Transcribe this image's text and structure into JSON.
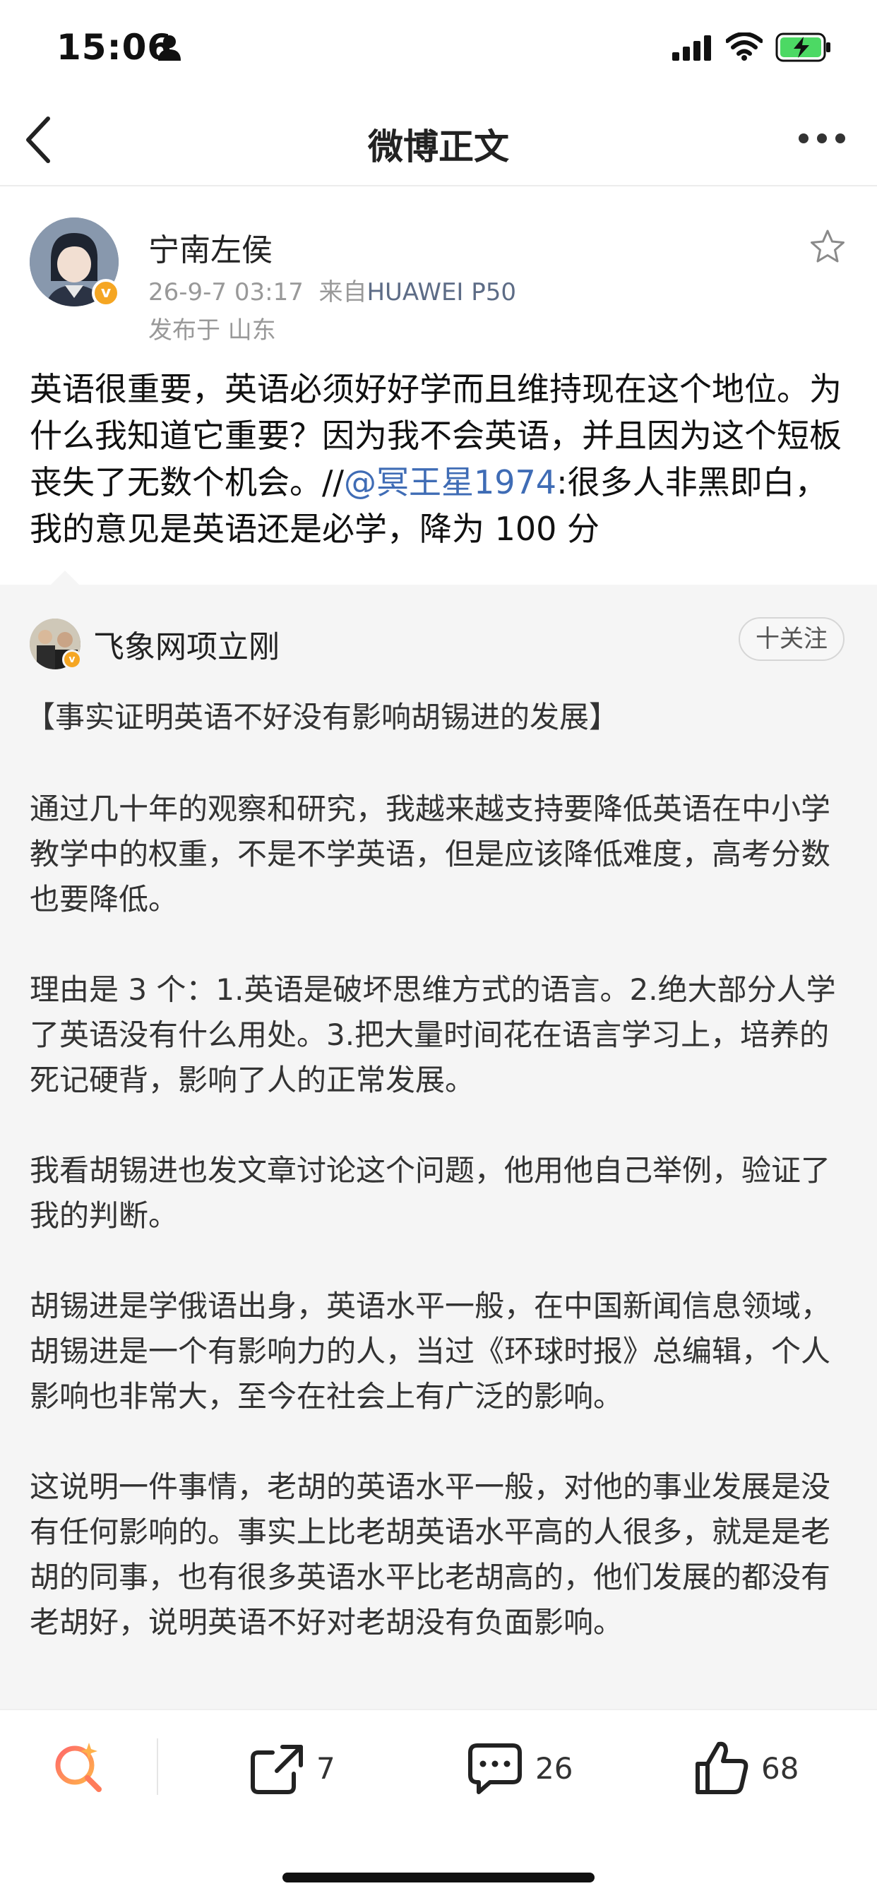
{
  "status_bar": {
    "time": "15:06"
  },
  "nav": {
    "title": "微博正文"
  },
  "post": {
    "author": "宁南左侯",
    "date": "26-9-7 03:17",
    "from_label": "来自",
    "device": "HUAWEI P50",
    "location": "发布于 山东",
    "text_before_mention": "英语很重要，英语必须好好学而且维持现在这个地位。为什么我知道它重要？因为我不会英语，并且因为这个短板丧失了无数个机会。//",
    "mention": "@冥王星1974",
    "text_after_mention": ":很多人非黑即白，我的意见是英语还是必学，降为 100 分"
  },
  "retweet": {
    "author": "飞象网项立刚",
    "follow_label": "十关注",
    "title": "【事实证明英语不好没有影响胡锡进的发展】",
    "paragraphs": [
      "通过几十年的观察和研究，我越来越支持要降低英语在中小学教学中的权重，不是不学英语，但是应该降低难度，高考分数也要降低。",
      "理由是 3 个：1.英语是破坏思维方式的语言。2.绝大部分人学了英语没有什么用处。3.把大量时间花在语言学习上，培养的死记硬背，影响了人的正常发展。",
      "我看胡锡进也发文章讨论这个问题，他用他自己举例，验证了我的判断。",
      "胡锡进是学俄语出身，英语水平一般，在中国新闻信息领域，胡锡进是一个有影响力的人，当过《环球时报》总编辑，个人影响也非常大，至今在社会上有广泛的影响。",
      "这说明一件事情，老胡的英语水平一般，对他的事业发展是没有任何影响的。事实上比老胡英语水平高的人很多，就是是老胡的同事，也有很多英语水平比老胡高的，他们发展的都没有老胡好，说明英语不好对老胡没有负面影响。"
    ]
  },
  "actions": {
    "repost_count": "7",
    "comment_count": "26",
    "like_count": "68"
  },
  "icons": {
    "back": "chevron-left-icon",
    "more": "more-dots-icon",
    "star": "star-icon",
    "search": "smart-search-icon",
    "repost": "repost-icon",
    "comment": "comment-icon",
    "like": "like-icon"
  },
  "colors": {
    "mention": "#3f6cb5",
    "badge": "#f5a623",
    "search_gradient_start": "#ff6a6a",
    "search_gradient_end": "#ffb14a"
  }
}
